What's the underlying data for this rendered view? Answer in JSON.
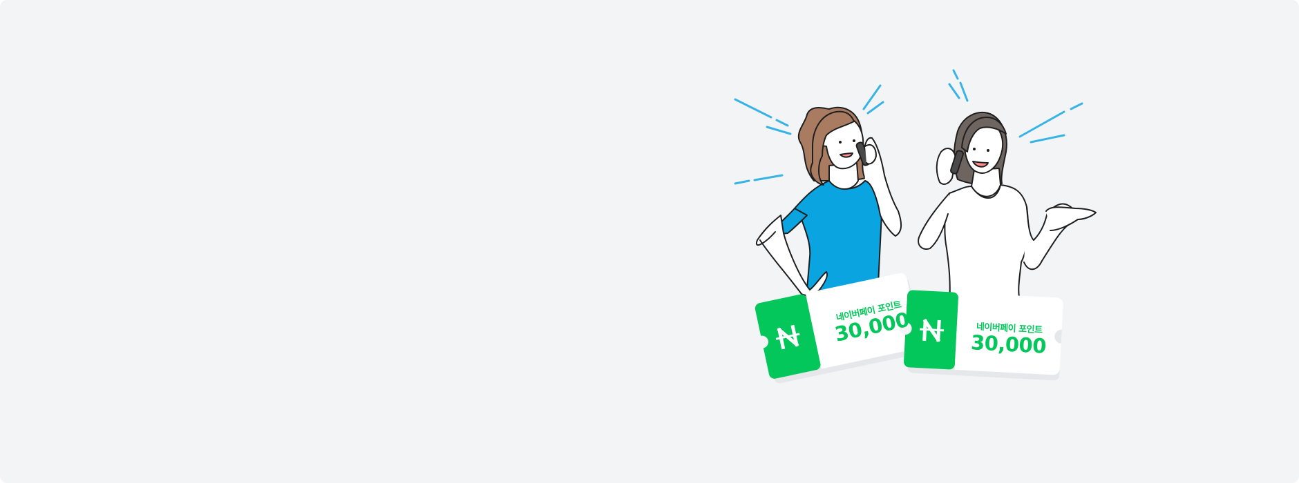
{
  "banner": {
    "coupons": [
      {
        "logo_glyph": "N",
        "label": "네이버페이 포인트",
        "amount": "30,000"
      },
      {
        "logo_glyph": "N",
        "label": "네이버페이 포인트",
        "amount": "30,000"
      }
    ],
    "colors": {
      "background": "#f3f4f6",
      "brand_green": "#03c75a",
      "shirt_blue": "#0aa4e0",
      "hair_brown": "#a97c62",
      "hair_dark": "#6e6560",
      "accent_lines": "#37b3e6"
    },
    "illustration": {
      "figures": [
        "woman-blue-shirt-on-phone",
        "woman-white-shirt-on-phone"
      ],
      "icons": [
        "naver-pay-n-icon",
        "naver-pay-n-icon"
      ]
    }
  }
}
